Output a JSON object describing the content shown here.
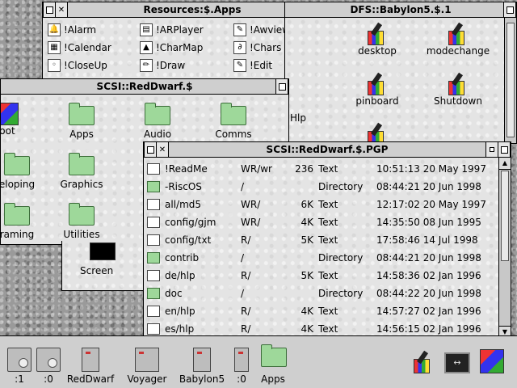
{
  "resources_window": {
    "title": "Resources:$.Apps",
    "items": [
      {
        "label": "!Alarm",
        "icon": "bell-icon"
      },
      {
        "label": "!ARPlayer",
        "icon": "film-icon"
      },
      {
        "label": "!Awviewer",
        "icon": "browser-icon"
      },
      {
        "label": "!Calendar",
        "icon": "calendar-icon"
      },
      {
        "label": "!CharMap",
        "icon": "charmap-icon"
      },
      {
        "label": "!Chars",
        "icon": "chars-icon"
      },
      {
        "label": "!CloseUp",
        "icon": "magnifier-icon"
      },
      {
        "label": "!Draw",
        "icon": "pencil-icon"
      },
      {
        "label": "!Edit",
        "icon": "edit-icon"
      }
    ]
  },
  "dfs_window": {
    "title": "DFS::Babylon5.$.1",
    "items": [
      {
        "label": "desktop"
      },
      {
        "label": "modechange"
      },
      {
        "label": "pinboard"
      },
      {
        "label": "Shutdown"
      }
    ],
    "partial_label": "Hlp"
  },
  "reddwarf_window": {
    "title": "SCSI::RedDwarf.$",
    "items": [
      {
        "label": "oot"
      },
      {
        "label": "Apps"
      },
      {
        "label": "Audio"
      },
      {
        "label": "Comms"
      },
      {
        "label": "eloping"
      },
      {
        "label": "Graphics"
      },
      {
        "label": "raming"
      },
      {
        "label": "Utilities"
      }
    ],
    "screen_label": "Screen"
  },
  "pgp_window": {
    "title": "SCSI::RedDwarf.$.PGP",
    "rows": [
      {
        "name": "!ReadMe",
        "access": "WR/wr",
        "size": "236",
        "type": "Text",
        "date": "10:51:13 20 May 1997",
        "folder": false
      },
      {
        "name": "-RiscOS",
        "access": "/",
        "size": "",
        "type": "Directory",
        "date": "08:44:21 20 Jun 1998",
        "folder": true
      },
      {
        "name": "all/md5",
        "access": "WR/",
        "size": "6K",
        "type": "Text",
        "date": "12:17:02 20 May 1997",
        "folder": false
      },
      {
        "name": "config/gjm",
        "access": "WR/",
        "size": "4K",
        "type": "Text",
        "date": "14:35:50 08 Jun 1995",
        "folder": false
      },
      {
        "name": "config/txt",
        "access": "R/",
        "size": "5K",
        "type": "Text",
        "date": "17:58:46 14 Jul 1998",
        "folder": false
      },
      {
        "name": "contrib",
        "access": "/",
        "size": "",
        "type": "Directory",
        "date": "08:44:21 20 Jun 1998",
        "folder": true
      },
      {
        "name": "de/hlp",
        "access": "R/",
        "size": "5K",
        "type": "Text",
        "date": "14:58:36 02 Jan 1996",
        "folder": false
      },
      {
        "name": "doc",
        "access": "/",
        "size": "",
        "type": "Directory",
        "date": "08:44:22 20 Jun 1998",
        "folder": true
      },
      {
        "name": "en/hlp",
        "access": "R/",
        "size": "4K",
        "type": "Text",
        "date": "14:57:27 02 Jan 1996",
        "folder": false
      },
      {
        "name": "es/hlp",
        "access": "R/",
        "size": "4K",
        "type": "Text",
        "date": "14:56:15 02 Jan 1996",
        "folder": false
      }
    ]
  },
  "iconbar": {
    "items": [
      {
        "label": ":1",
        "icon": "floppy-disc-icon"
      },
      {
        "label": ":0",
        "icon": "floppy-disc-icon"
      },
      {
        "label": "RedDwarf",
        "icon": "harddisc-icon"
      },
      {
        "label": "Voyager",
        "icon": "network-disc-icon"
      },
      {
        "label": "Babylon5",
        "icon": "harddisc-icon"
      },
      {
        "label": ":0",
        "icon": "ram-disc-icon"
      },
      {
        "label": "Apps",
        "icon": "apps-folder-icon"
      }
    ]
  }
}
